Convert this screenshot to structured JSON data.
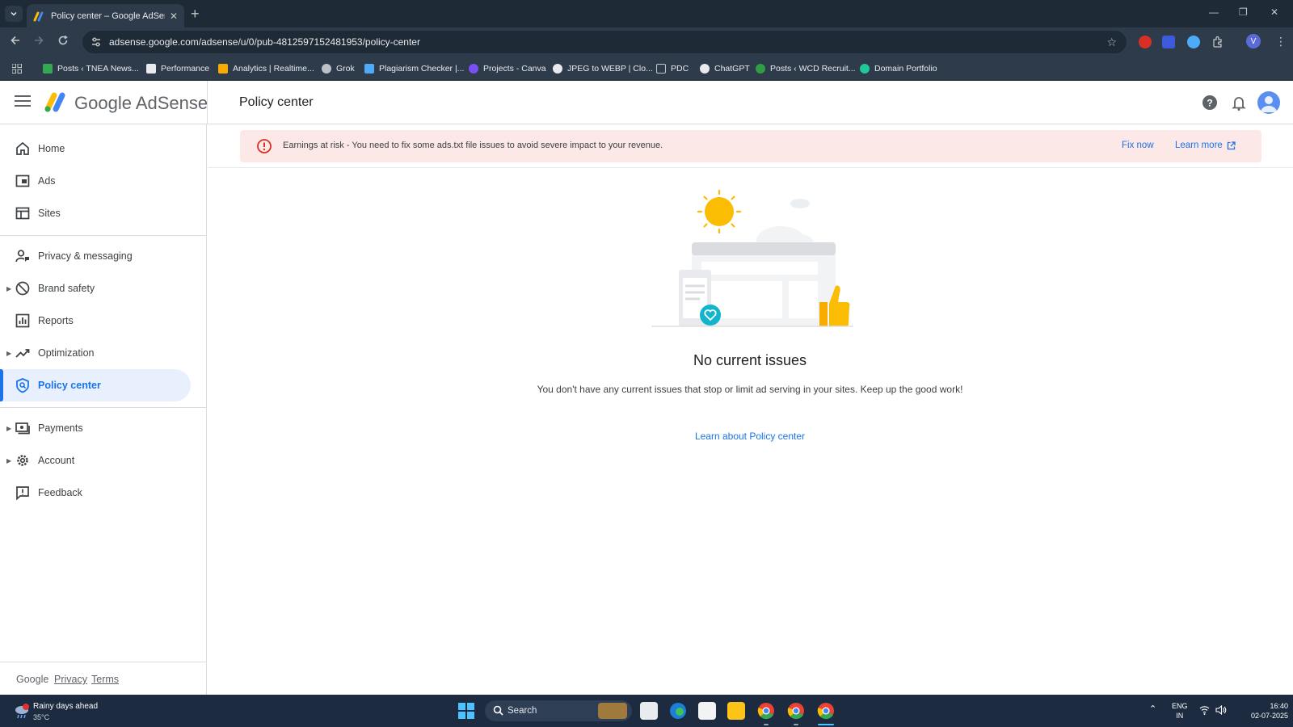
{
  "browser": {
    "tab_title": "Policy center – Google AdSense",
    "url": "adsense.google.com/adsense/u/0/pub-4812597152481953/policy-center",
    "profile_initial": "V",
    "bookmarks": [
      "Posts ‹ TNEA News...",
      "Performance",
      "Analytics | Realtime...",
      "Grok",
      "Plagiarism Checker |...",
      "Projects - Canva",
      "JPEG to WEBP | Clo...",
      "PDC",
      "ChatGPT",
      "Posts ‹ WCD Recruit...",
      "Domain Portfolio"
    ]
  },
  "header": {
    "brand": "Google AdSense",
    "page_title": "Policy center"
  },
  "sidebar": {
    "items": [
      {
        "label": "Home",
        "icon": "home-icon"
      },
      {
        "label": "Ads",
        "icon": "ads-icon"
      },
      {
        "label": "Sites",
        "icon": "sites-icon"
      },
      {
        "label": "Privacy & messaging",
        "icon": "privacy-messaging-icon"
      },
      {
        "label": "Brand safety",
        "icon": "brand-safety-icon"
      },
      {
        "label": "Reports",
        "icon": "reports-icon"
      },
      {
        "label": "Optimization",
        "icon": "optimization-icon"
      },
      {
        "label": "Policy center",
        "icon": "policy-center-icon"
      },
      {
        "label": "Payments",
        "icon": "payments-icon"
      },
      {
        "label": "Account",
        "icon": "account-icon"
      },
      {
        "label": "Feedback",
        "icon": "feedback-icon"
      }
    ],
    "footer": {
      "google": "Google",
      "privacy": "Privacy",
      "terms": "Terms"
    }
  },
  "alert": {
    "text": "Earnings at risk - You need to fix some ads.txt file issues to avoid severe impact to your revenue.",
    "fix_label": "Fix now",
    "learn_label": "Learn more"
  },
  "main": {
    "empty_title": "No current issues",
    "empty_description": "You don't have any current issues that stop or limit ad serving in your sites. Keep up the good work!",
    "learn_link": "Learn about Policy center"
  },
  "taskbar": {
    "weather_title": "Rainy days ahead",
    "weather_temp": "35°C",
    "search_label": "Search",
    "lang_line1": "ENG",
    "lang_line2": "IN",
    "time": "16:40",
    "date": "02-07-2025"
  },
  "colors": {
    "accent": "#1a73e8",
    "alert_bg": "#fce8e6",
    "alert_icon": "#d93025",
    "active_nav_bg": "#e8f0fe",
    "chrome_dark": "#1f2a37"
  }
}
